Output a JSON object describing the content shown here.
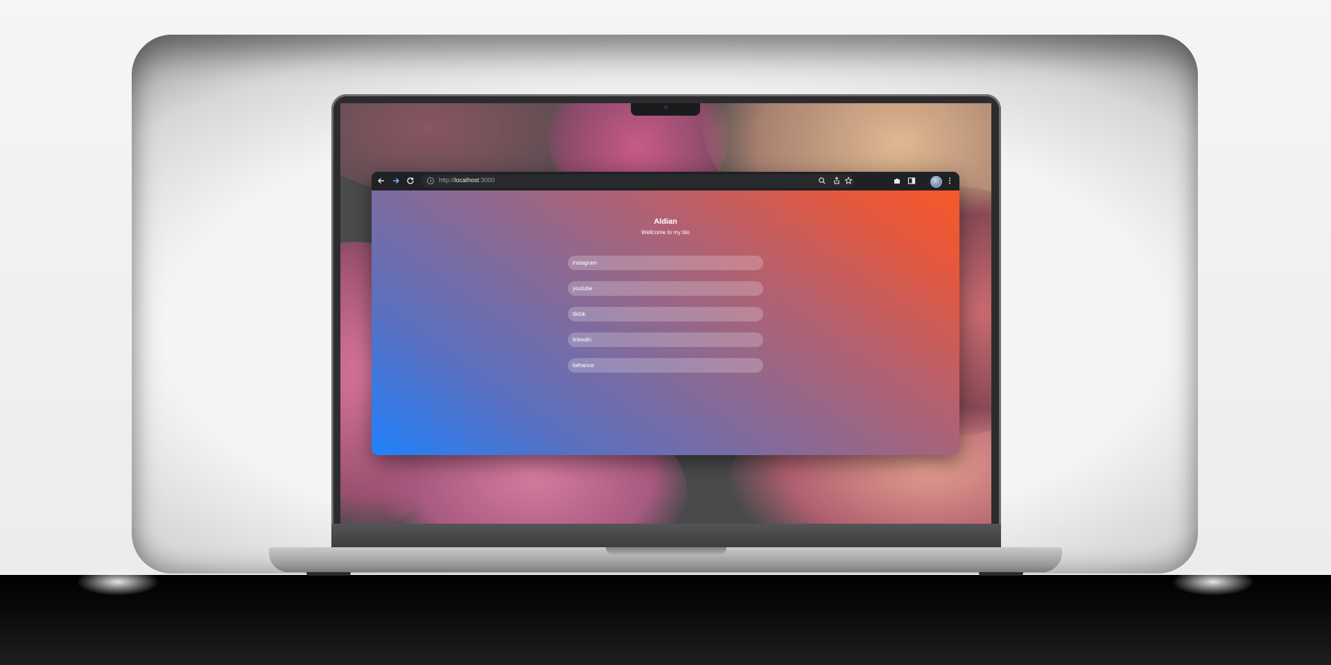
{
  "browser": {
    "url_scheme": "http://",
    "url_host": "localhost",
    "url_port": ":3000"
  },
  "page": {
    "name": "Aldian",
    "subtitle": "Wellcome to my bio",
    "links": [
      {
        "label": "instagram"
      },
      {
        "label": "youtube"
      },
      {
        "label": "tiktok"
      },
      {
        "label": "linkedin"
      },
      {
        "label": "behance"
      }
    ]
  },
  "colors": {
    "gradient_start": "#2181fc",
    "gradient_end": "#f5582a",
    "toolbar": "#202124"
  }
}
